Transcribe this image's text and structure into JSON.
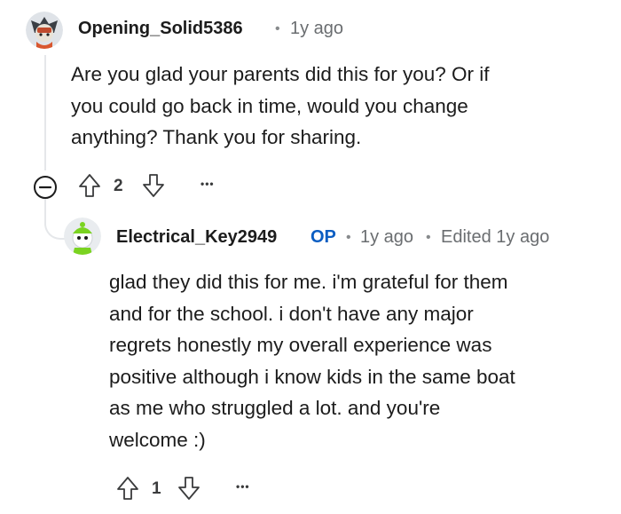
{
  "comment": {
    "username": "Opening_Solid5386",
    "separator": "•",
    "time": "1y ago",
    "body_lines": [
      "Are you glad your parents did this for you? Or if",
      "you could go back in time, would you change",
      "anything? Thank you for sharing."
    ],
    "votes": "2",
    "more": "•••"
  },
  "reply": {
    "username": "Electrical_Key2949",
    "op_badge": "OP",
    "separator": "•",
    "time": "1y ago",
    "edited": "Edited 1y ago",
    "body_lines": [
      "glad they did this for me. i'm grateful for them",
      "and for the school. i don't have any major",
      "regrets honestly my overall experience was",
      "positive although i know kids in the same boat",
      "as me who struggled a lot. and you're",
      "welcome :)"
    ],
    "votes": "1",
    "more": "•••"
  },
  "colors": {
    "op_badge": "#0a5dc2",
    "meta": "#6a6d70",
    "thread_line": "#e5e7ea"
  }
}
